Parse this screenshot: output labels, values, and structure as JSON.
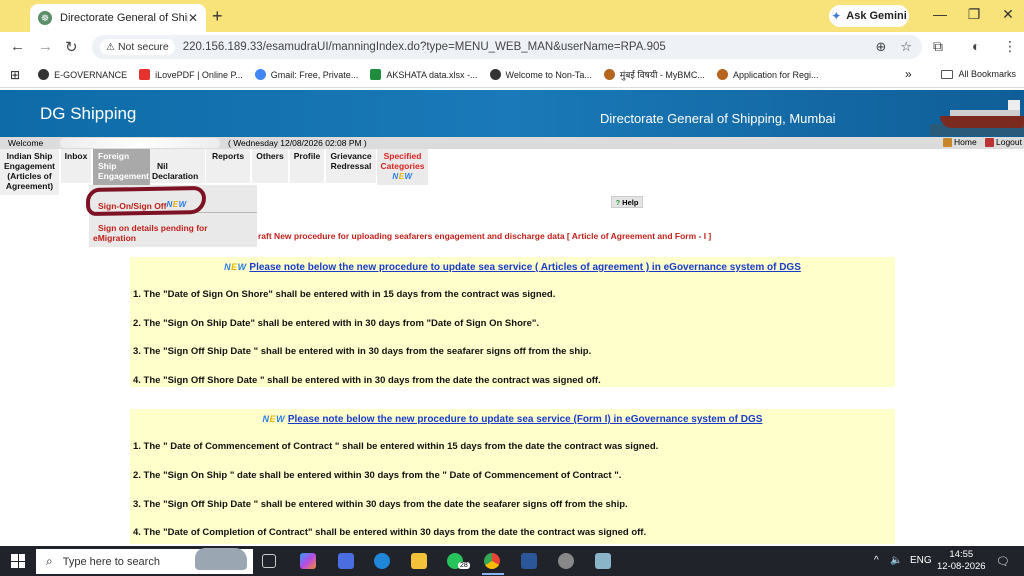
{
  "browser": {
    "tab_title": "Directorate General of Shipping",
    "new_tab": "+",
    "tab_close": "✕",
    "gemini_label": "Ask Gemini",
    "not_secure_label": "Not secure",
    "url": "220.156.189.33/esamudraUI/manningIndex.do?type=MENU_WEB_MAN&userName=RPA.905",
    "bookmarks": [
      {
        "label": "E-GOVERNANCE",
        "color": "#333333"
      },
      {
        "label": "iLovePDF | Online P...",
        "color": "#e5322d"
      },
      {
        "label": "Gmail: Free, Private...",
        "color": "#4285f4"
      },
      {
        "label": "AKSHATA data.xlsx -...",
        "color": "#1e8e3e"
      },
      {
        "label": "Welcome to Non-Ta...",
        "color": "#333333"
      },
      {
        "label": "मुंबई विषयी - MyBMC...",
        "color": "#b5651d"
      },
      {
        "label": "Application for Regi...",
        "color": "#b5651d"
      }
    ],
    "more_bookmarks": "»",
    "all_bookmarks": "All Bookmarks"
  },
  "site": {
    "name": "DG Shipping",
    "department": "Directorate General of Shipping, Mumbai"
  },
  "welcome": {
    "label": "Welcome",
    "datetime": "( Wednesday 12/08/2026 02:08 PM )",
    "home": "Home",
    "logout": "Logout"
  },
  "menu": {
    "indian_ship": [
      "Indian Ship",
      "Engagement",
      "(Articles of",
      "Agreement)"
    ],
    "inbox": "Inbox",
    "foreign_ship": [
      "Foreign",
      "Ship",
      "Engagement"
    ],
    "nil_declaration": [
      "Nil",
      "Declaration"
    ],
    "reports": "Reports",
    "others": "Others",
    "profile": "Profile",
    "grievance": [
      "Grievance",
      "Redressal"
    ],
    "specified": [
      "Specified",
      "Categories"
    ],
    "new_badge": [
      "N",
      "E",
      "W"
    ]
  },
  "dropdown": {
    "sign_on_off": "Sign-On/Sign Off",
    "pending": [
      "Sign on details pending for",
      "eMigration"
    ]
  },
  "help": "Help",
  "draft_notice": "raft New procedure for uploading seafarers engagement and discharge data [  Article of Agreement and Form - I ]",
  "section1": {
    "title": "Please note below the new procedure to update sea service ( Articles of agreement ) in eGovernance system of DGS",
    "rules": [
      "1. The \"Date of Sign On Shore\" shall be entered with in 15 days from the contract was signed.",
      "2. The \"Sign On Ship Date\" shall be entered with in 30 days from \"Date of Sign On Shore\".",
      "3. The \"Sign Off Ship Date \" shall be entered with in 30 days from the seafarer signs off from the ship.",
      "4. The \"Sign Off Shore Date \" shall be entered with in 30 days from the date the contract was signed off."
    ]
  },
  "section2": {
    "title": "Please note below the new procedure to update sea service (Form I) in eGovernance system of DGS",
    "rules": [
      "1. The \" Date of Commencement of Contract \" shall be entered within 15 days from the date the contract was signed.",
      "2. The \"Sign On Ship \" date shall be entered within 30 days from the \" Date of Commencement of Contract \".",
      "3. The \"Sign Off Ship Date \" shall be entered within 30 days from the date the seafarer signs off from the ship.",
      "4. The \"Date of Completion of Contract\" shall be entered within 30 days from the date the contract was signed off."
    ]
  },
  "taskbar": {
    "search_placeholder": "Type here to search",
    "whatsapp_badge": "28",
    "lang": "ENG",
    "time": "14:55",
    "date": "12-08-2026"
  }
}
